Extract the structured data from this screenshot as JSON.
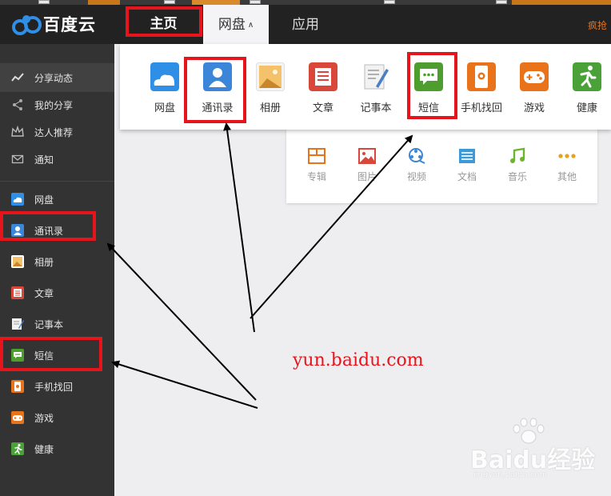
{
  "app": {
    "logo_text": "百度云",
    "brand_blue": "#2f8ee6"
  },
  "header": {
    "nav": {
      "home": "主页",
      "disk": "网盘",
      "app": "应用"
    },
    "right_text": "疯抢"
  },
  "sidebar": {
    "items": [
      {
        "label": "分享动态",
        "icon": "activity-icon"
      },
      {
        "label": "我的分享",
        "icon": "share-icon"
      },
      {
        "label": "达人推荐",
        "icon": "crown-icon"
      },
      {
        "label": "通知",
        "icon": "mail-icon"
      },
      {
        "label": "网盘",
        "icon": "cloud-icon"
      },
      {
        "label": "通讯录",
        "icon": "contacts-icon"
      },
      {
        "label": "相册",
        "icon": "photo-icon"
      },
      {
        "label": "文章",
        "icon": "article-icon"
      },
      {
        "label": "记事本",
        "icon": "notepad-icon"
      },
      {
        "label": "短信",
        "icon": "sms-icon"
      },
      {
        "label": "手机找回",
        "icon": "phone-icon"
      },
      {
        "label": "游戏",
        "icon": "gamepad-icon"
      },
      {
        "label": "健康",
        "icon": "runner-icon"
      }
    ]
  },
  "dropdown": {
    "items": [
      {
        "label": "网盘",
        "icon": "cloud-icon",
        "color": "#2f8ee6"
      },
      {
        "label": "通讯录",
        "icon": "contacts-icon",
        "color": "#3b86d8"
      },
      {
        "label": "相册",
        "icon": "photo-icon",
        "color": "#e9a443"
      },
      {
        "label": "文章",
        "icon": "article-icon",
        "color": "#d9473a"
      },
      {
        "label": "记事本",
        "icon": "notepad-icon",
        "color": "#4a7ec6"
      },
      {
        "label": "短信",
        "icon": "sms-icon",
        "color": "#4d9d2f"
      },
      {
        "label": "手机找回",
        "icon": "phone-icon",
        "color": "#e8731a"
      },
      {
        "label": "游戏",
        "icon": "gamepad-icon",
        "color": "#e8731a"
      },
      {
        "label": "健康",
        "icon": "runner-icon",
        "color": "#4aa137"
      }
    ]
  },
  "panel": {
    "items": [
      {
        "label": "专辑",
        "icon": "album-icon",
        "color": "#e8731a"
      },
      {
        "label": "图片",
        "icon": "image-icon",
        "color": "#d9473a"
      },
      {
        "label": "视频",
        "icon": "video-icon",
        "color": "#3b86d8"
      },
      {
        "label": "文档",
        "icon": "document-icon",
        "color": "#3b9bd8"
      },
      {
        "label": "音乐",
        "icon": "music-icon",
        "color": "#6cb52f"
      },
      {
        "label": "其他",
        "icon": "more-icon",
        "color": "#e8a21a"
      }
    ]
  },
  "annotation": {
    "url": "yun.baidu.com",
    "color": "#e8141c"
  },
  "watermark": {
    "main": "Baidu经验",
    "sub": "jingyan.baidu.com"
  }
}
